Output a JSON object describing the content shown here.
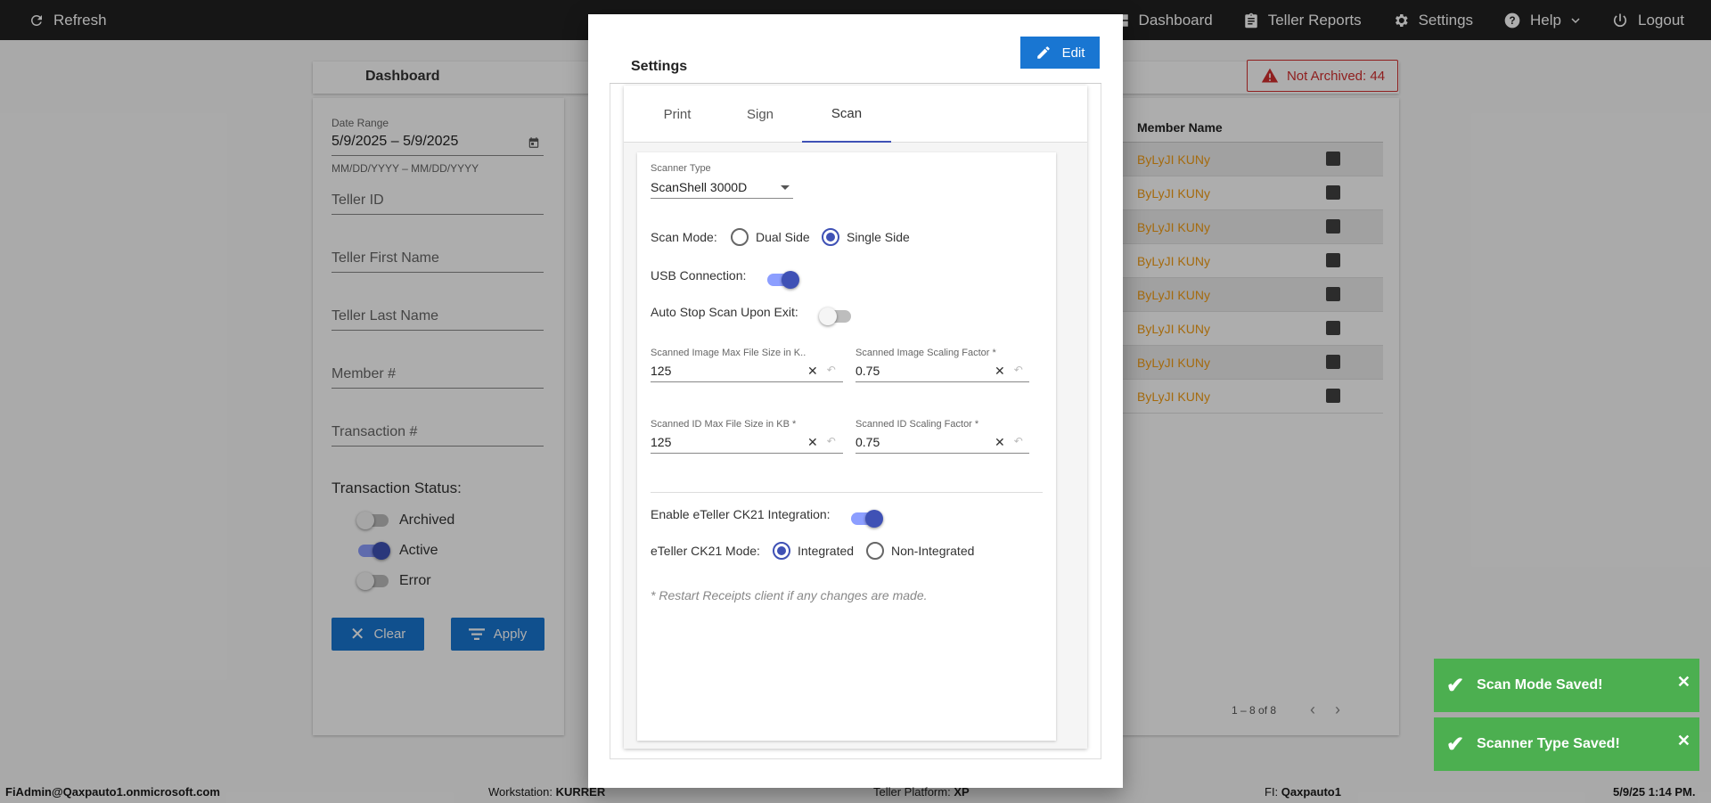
{
  "topbar": {
    "refresh_label": "Refresh",
    "nav": [
      {
        "label": "Dashboard",
        "icon": "grid-icon"
      },
      {
        "label": "Teller Reports",
        "icon": "clipboard-icon"
      },
      {
        "label": "Settings",
        "icon": "gear-icon"
      },
      {
        "label": "Help",
        "icon": "help-icon"
      },
      {
        "label": "Logout",
        "icon": "power-icon"
      }
    ]
  },
  "dashboard": {
    "title": "Dashboard",
    "not_archived": "Not Archived: 44",
    "filters": {
      "date_range_label": "Date Range",
      "date_range_value": "5/9/2025 – 5/9/2025",
      "date_hint": "MM/DD/YYYY – MM/DD/YYYY",
      "teller_id": "Teller ID",
      "teller_first": "Teller First Name",
      "teller_last": "Teller Last Name",
      "member_no": "Member #",
      "transaction_no": "Transaction #",
      "status_title": "Transaction Status:",
      "archived": "Archived",
      "active": "Active",
      "error": "Error",
      "clear": "Clear",
      "apply": "Apply"
    },
    "table": {
      "member_header": "Member Name",
      "rows": [
        "ByLyJI KUNy",
        "ByLyJI KUNy",
        "ByLyJI KUNy",
        "ByLyJI KUNy",
        "ByLyJI KUNy",
        "ByLyJI KUNy",
        "ByLyJI KUNy",
        "ByLyJI KUNy"
      ],
      "pager": "1 – 8 of 8"
    }
  },
  "dialog": {
    "title": "Settings",
    "edit": "Edit",
    "tabs": [
      "Print",
      "Sign",
      "Scan"
    ],
    "active_tab": "Scan",
    "scanner_type_label": "Scanner Type",
    "scanner_type_value": "ScanShell 3000D",
    "scan_mode_label": "Scan Mode:",
    "scan_mode_dual": "Dual Side",
    "scan_mode_single": "Single Side",
    "usb_label": "USB Connection:",
    "auto_stop_label": "Auto Stop Scan Upon Exit:",
    "img_max_label": "Scanned Image Max File Size in K...",
    "img_max_value": "125",
    "img_scale_label": "Scanned Image Scaling Factor *",
    "img_scale_value": "0.75",
    "id_max_label": "Scanned ID Max File Size in KB *",
    "id_max_value": "125",
    "id_scale_label": "Scanned ID Scaling Factor *",
    "id_scale_value": "0.75",
    "ck21_label": "Enable eTeller CK21 Integration:",
    "ck21_mode_label": "eTeller CK21 Mode:",
    "ck21_integrated": "Integrated",
    "ck21_non": "Non-Integrated",
    "note": "* Restart Receipts client if any changes are made."
  },
  "toasts": [
    "Scan Mode Saved!",
    "Scanner Type Saved!"
  ],
  "footer": {
    "user": "FiAdmin@Qaxpauto1.onmicrosoft.com",
    "workstation_label": "Workstation: ",
    "workstation": "KURRER",
    "platform_label": "Teller Platform: ",
    "platform": "XP",
    "fi_label": "FI: ",
    "fi": "Qaxpauto1",
    "datetime": "5/9/25 1:14 PM."
  },
  "colors": {
    "primary": "#1976d2",
    "accent": "#3f51b5",
    "success": "#4caf50",
    "error": "#d32f2f",
    "member_link": "#f39c12"
  }
}
